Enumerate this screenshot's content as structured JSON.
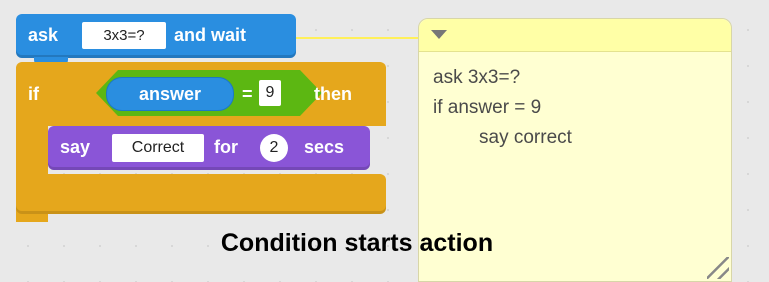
{
  "script": {
    "ask_block": {
      "label": "ask",
      "question": "3x3=?",
      "suffix": "and wait"
    },
    "if_block": {
      "label": "if",
      "then_label": "then",
      "condition": {
        "variable": "answer",
        "operator": "=",
        "value": "9"
      }
    },
    "say_block": {
      "label": "say",
      "message": "Correct",
      "for_label": "for",
      "seconds": "2",
      "secs_label": "secs"
    }
  },
  "note": {
    "lines": [
      "ask 3x3=?",
      "if answer = 9",
      "say correct"
    ]
  },
  "caption": "Condition starts action",
  "colors": {
    "sensing_blue": "#2a8ee0",
    "control_orange": "#e5a71c",
    "operator_green": "#5cb712",
    "looks_purple": "#8a55d7",
    "note_yellow": "#ffffd2"
  },
  "icons": {
    "note_toggle": "triangle-down-icon",
    "note_resize": "resize-handle-icon"
  }
}
